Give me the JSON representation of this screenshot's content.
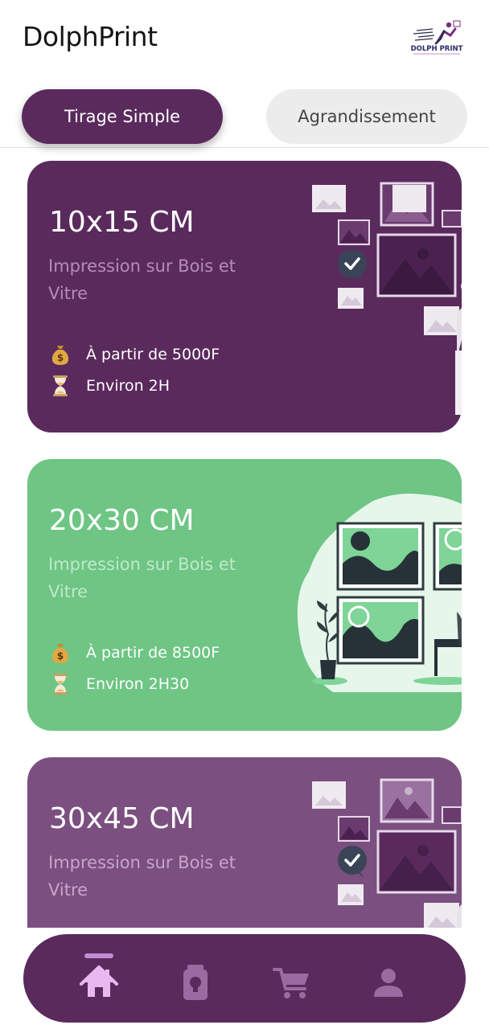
{
  "app": {
    "title": "DolphPrint",
    "logo_text": "DOLPH PRINT"
  },
  "tabs": [
    {
      "label": "Tirage Simple",
      "active": true
    },
    {
      "label": "Agrandissement",
      "active": false
    }
  ],
  "cards": [
    {
      "title": "10x15 CM",
      "description": "Impression sur Bois et Vitre",
      "price": "À partir de 5000F",
      "duration": "Environ 2H",
      "background": "#5a2a5d",
      "description_color": "#b48cb8"
    },
    {
      "title": "20x30 CM",
      "description": "Impression sur Bois et Vitre",
      "price": "À partir de 8500F",
      "duration": "Environ 2H30",
      "background": "#6ec584",
      "description_color": "#bfe9c9"
    },
    {
      "title": "30x45 CM",
      "description": "Impression sur Bois et Vitre",
      "background": "#7b4f80",
      "description_color": "#c6a6c9"
    }
  ],
  "bottom_nav": {
    "items": [
      {
        "name": "home-icon",
        "active": true
      },
      {
        "name": "idea-icon",
        "active": false
      },
      {
        "name": "cart-icon",
        "active": false
      },
      {
        "name": "profile-icon",
        "active": false
      }
    ],
    "active_color": "#e8b8f0",
    "inactive_color": "#9a6aa0"
  },
  "colors": {
    "primary": "#5a2a5d",
    "green": "#6ec584",
    "tab_inactive_bg": "#ececec"
  }
}
